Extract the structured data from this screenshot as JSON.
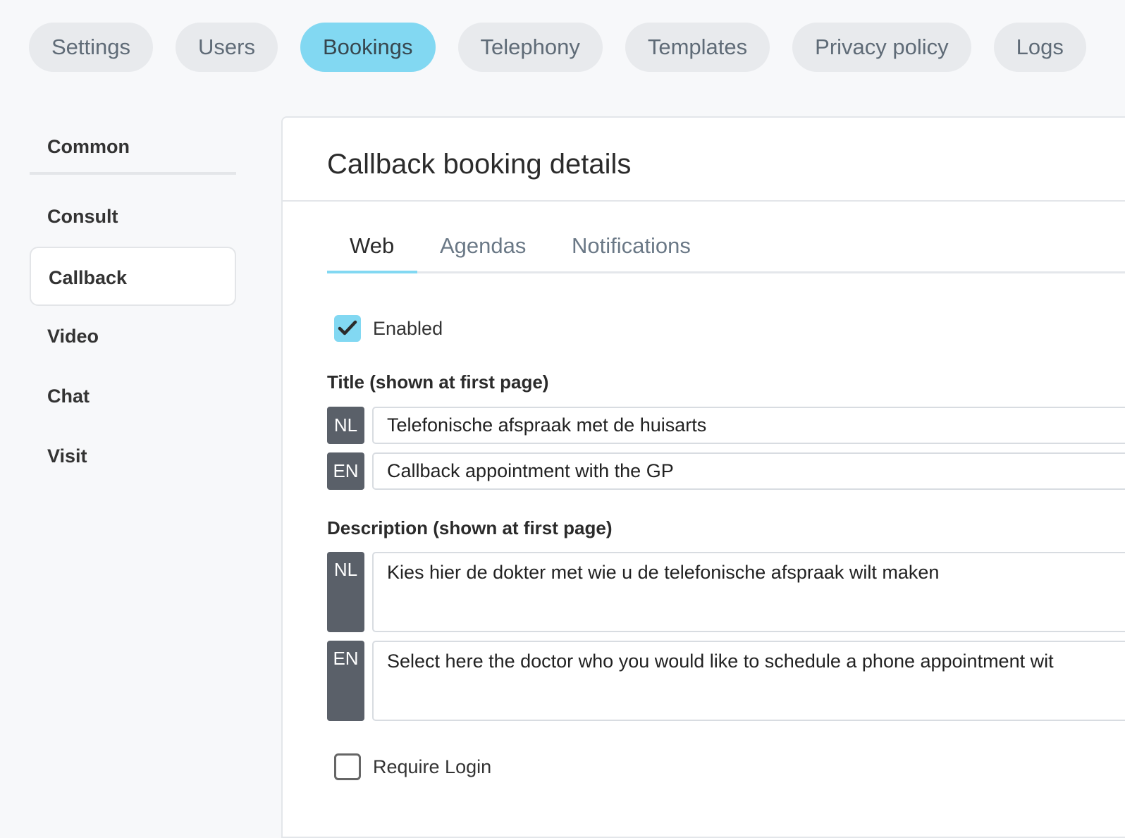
{
  "top_nav": {
    "items": [
      {
        "label": "Settings"
      },
      {
        "label": "Users"
      },
      {
        "label": "Bookings",
        "active": true
      },
      {
        "label": "Telephony"
      },
      {
        "label": "Templates"
      },
      {
        "label": "Privacy policy"
      },
      {
        "label": "Logs"
      }
    ]
  },
  "sidebar": {
    "items": [
      {
        "label": "Common"
      },
      {
        "label": "Consult"
      },
      {
        "label": "Callback",
        "active": true
      },
      {
        "label": "Video"
      },
      {
        "label": "Chat"
      },
      {
        "label": "Visit"
      }
    ]
  },
  "panel": {
    "title": "Callback booking details",
    "tabs": [
      {
        "label": "Web",
        "active": true
      },
      {
        "label": "Agendas"
      },
      {
        "label": "Notifications"
      }
    ],
    "enabled": {
      "label": "Enabled",
      "checked": true
    },
    "title_section": {
      "label": "Title (shown at first page)",
      "nl": {
        "lang": "NL",
        "value": "Telefonische afspraak met de huisarts"
      },
      "en": {
        "lang": "EN",
        "value": "Callback appointment with the GP"
      }
    },
    "description_section": {
      "label": "Description (shown at first page)",
      "nl": {
        "lang": "NL",
        "value": "Kies hier de dokter met wie u de telefonische afspraak wilt maken"
      },
      "en": {
        "lang": "EN",
        "value": "Select here the doctor who you would like to schedule a phone appointment wit"
      }
    },
    "require_login": {
      "label": "Require Login",
      "checked": false
    }
  },
  "colors": {
    "accent": "#82d8f2",
    "badge": "#5a6069",
    "pill_bg": "#e8eaed"
  }
}
